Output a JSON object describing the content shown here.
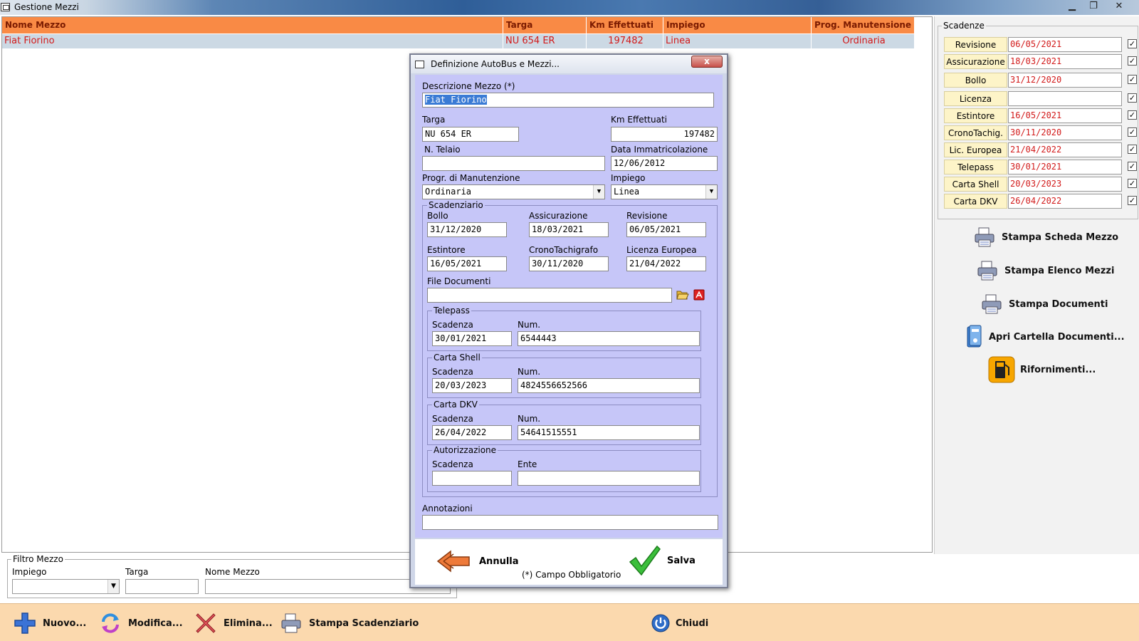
{
  "window": {
    "title": "Gestione  Mezzi"
  },
  "grid": {
    "columns": [
      "Nome Mezzo",
      "Targa",
      "Km Effettuati",
      "Impiego",
      "Prog. Manutensione"
    ],
    "rows": [
      {
        "nome": "Fiat Fiorino",
        "targa": "NU 654 ER",
        "km": "197482",
        "impiego": "Linea",
        "prog": "Ordinaria"
      }
    ]
  },
  "scadenze": {
    "title": "Scadenze",
    "items": [
      {
        "label": "Revisione",
        "value": "06/05/2021",
        "checked": true
      },
      {
        "label": "Assicurazione",
        "value": "18/03/2021",
        "checked": true
      },
      {
        "label": "Bollo",
        "value": "31/12/2020",
        "checked": true
      },
      {
        "label": "Licenza",
        "value": "",
        "checked": true
      },
      {
        "label": "Estintore",
        "value": "16/05/2021",
        "checked": true
      },
      {
        "label": "CronoTachig.",
        "value": "30/11/2020",
        "checked": true
      },
      {
        "label": "Lic. Europea",
        "value": "21/04/2022",
        "checked": true
      },
      {
        "label": "Telepass",
        "value": "30/01/2021",
        "checked": true
      },
      {
        "label": "Carta Shell",
        "value": "20/03/2023",
        "checked": true
      },
      {
        "label": "Carta DKV",
        "value": "26/04/2022",
        "checked": true
      }
    ]
  },
  "right_buttons": {
    "stampa_scheda": "Stampa Scheda Mezzo",
    "stampa_elenco": "Stampa Elenco Mezzi",
    "stampa_documenti": "Stampa Documenti",
    "apri_cartella": "Apri Cartella Documenti...",
    "rifornimenti": "Rifornimenti..."
  },
  "filter": {
    "title": "Filtro Mezzo",
    "impiego_label": "Impiego",
    "targa_label": "Targa",
    "nome_label": "Nome Mezzo"
  },
  "toolbar": {
    "nuovo": "Nuovo...",
    "modifica": "Modifica...",
    "elimina": "Elimina...",
    "stampa_scadenziario": "Stampa Scadenziario",
    "chiudi": "Chiudi"
  },
  "dialog": {
    "title": "Definizione AutoBus e Mezzi...",
    "close_label": "x",
    "descrizione_label": "Descrizione  Mezzo (*)",
    "descrizione_value": "Fiat Fiorino",
    "targa_label": "Targa",
    "targa_value": "NU 654 ER",
    "km_label": "Km Effettuati",
    "km_value": "197482",
    "telaio_label": "N. Telaio",
    "telaio_value": "",
    "data_imm_label": "Data Immatricolazione",
    "data_imm_value": "12/06/2012",
    "progr_label": "Progr. di Manutenzione",
    "progr_value": "Ordinaria",
    "impiego_label": "Impiego",
    "impiego_value": "Linea",
    "scadenziario": {
      "title": "Scadenziario",
      "bollo_label": "Bollo",
      "bollo_value": "31/12/2020",
      "assicurazione_label": "Assicurazione",
      "assicurazione_value": "18/03/2021",
      "revisione_label": "Revisione",
      "revisione_value": "06/05/2021",
      "estintore_label": "Estintore",
      "estintore_value": "16/05/2021",
      "crono_label": "CronoTachigrafo",
      "crono_value": "30/11/2020",
      "licenza_label": "Licenza Europea",
      "licenza_value": "21/04/2022",
      "file_label": "File Documenti",
      "file_value": "",
      "telepass": {
        "title": "Telepass",
        "scad_label": "Scadenza",
        "scad_value": "30/01/2021",
        "num_label": "Num.",
        "num_value": "6544443"
      },
      "shell": {
        "title": "Carta Shell",
        "scad_label": "Scadenza",
        "scad_value": "20/03/2023",
        "num_label": "Num.",
        "num_value": "4824556652566"
      },
      "dkv": {
        "title": "Carta DKV",
        "scad_label": "Scadenza",
        "scad_value": "26/04/2022",
        "num_label": "Num.",
        "num_value": "54641515551"
      },
      "autorizzazione": {
        "title": "Autorizzazione",
        "scad_label": "Scadenza",
        "scad_value": "",
        "ente_label": "Ente",
        "ente_value": ""
      }
    },
    "annotazioni_label": "Annotazioni",
    "annotazioni_value": "",
    "annulla_label": "Annulla",
    "salva_label": "Salva",
    "note": "(*) Campo Obbligatorio"
  }
}
